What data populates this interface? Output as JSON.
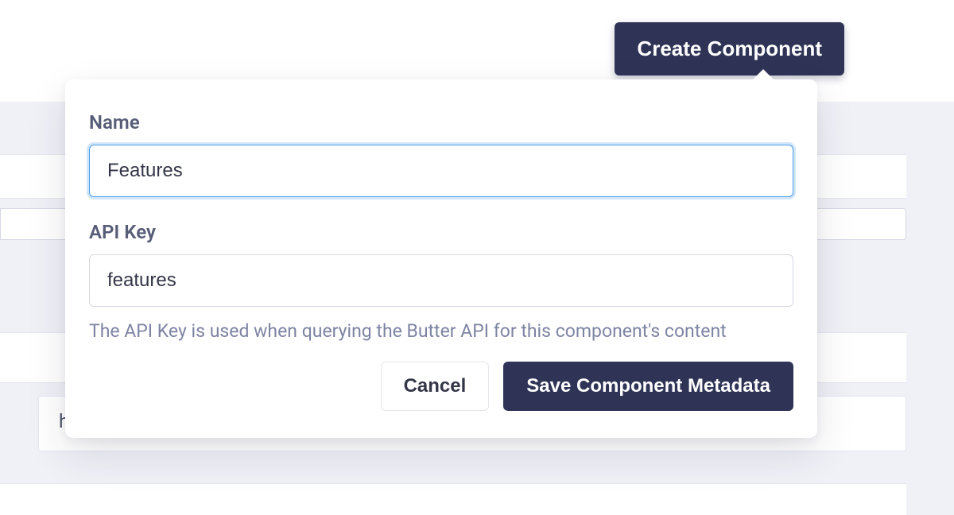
{
  "header": {
    "create_label": "Create Component"
  },
  "modal": {
    "name_label": "Name",
    "name_value": "Features",
    "apikey_label": "API Key",
    "apikey_value": "features",
    "apikey_help": "The API Key is used when querying the Butter API for this component's content",
    "cancel_label": "Cancel",
    "save_label": "Save Component Metadata"
  },
  "background": {
    "stray_char": "h"
  }
}
